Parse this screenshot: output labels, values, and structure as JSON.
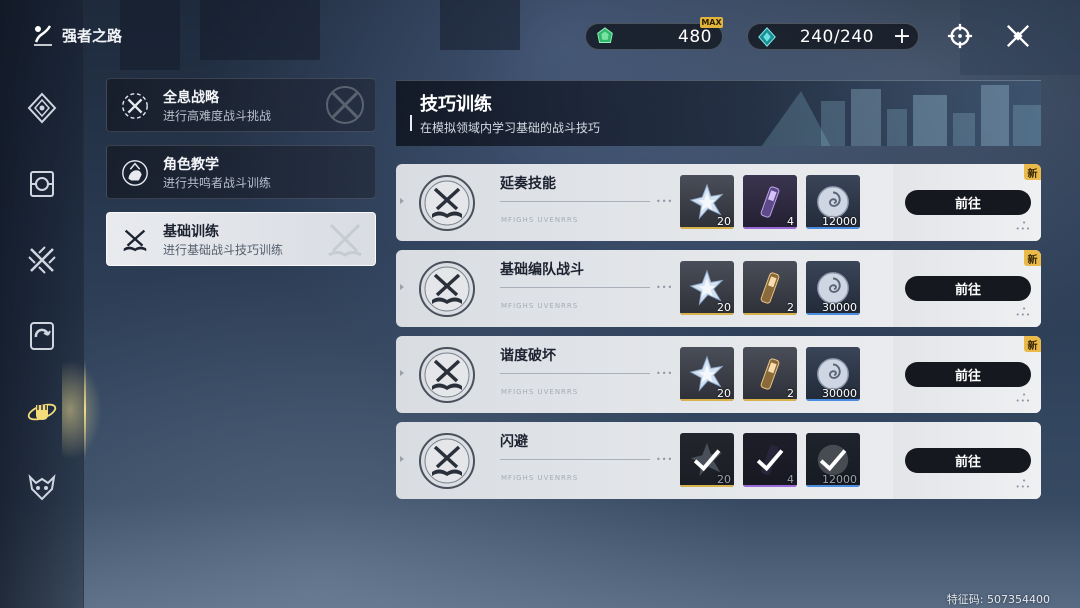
{
  "app": {
    "title": "强者之路"
  },
  "top_bar": {
    "currency_a": {
      "icon": "green-gem-icon",
      "value": "480",
      "badge": "MAX"
    },
    "currency_b": {
      "icon": "teal-crystal-icon",
      "value": "240/240",
      "plus": "+"
    },
    "icons": [
      "target-crosshair-icon",
      "close-x-icon"
    ]
  },
  "rail": {
    "items": [
      {
        "name": "diamond-emblem-icon",
        "active": false
      },
      {
        "name": "shield-card-icon",
        "active": false
      },
      {
        "name": "crossed-swords-icon",
        "active": false
      },
      {
        "name": "card-swirl-icon",
        "active": false
      },
      {
        "name": "fist-orbit-icon",
        "active": true
      },
      {
        "name": "demon-mask-icon",
        "active": false
      }
    ]
  },
  "categories": [
    {
      "title": "全息战略",
      "subtitle": "进行高难度战斗挑战",
      "active": false
    },
    {
      "title": "角色教学",
      "subtitle": "进行共鸣者战斗训练",
      "active": false
    },
    {
      "title": "基础训练",
      "subtitle": "进行基础战斗技巧训练",
      "active": true
    }
  ],
  "banner": {
    "title": "技巧训练",
    "subtitle": "在模拟领域内学习基础的战斗技巧"
  },
  "tasks": [
    {
      "name": "延奏技能",
      "deco": "MFIGHS   UVENRRS",
      "rewards": [
        {
          "type": "star-crystal",
          "rarity": "gold",
          "qty": "20",
          "claimed": false
        },
        {
          "type": "purple-vial",
          "rarity": "purple",
          "qty": "4",
          "claimed": false
        },
        {
          "type": "shell-coin",
          "rarity": "blue",
          "qty": "12000",
          "claimed": false
        }
      ],
      "button": "前往",
      "new_badge": "新"
    },
    {
      "name": "基础编队战斗",
      "deco": "MFIGHS   UVENRRS",
      "rewards": [
        {
          "type": "star-crystal",
          "rarity": "gold",
          "qty": "20",
          "claimed": false
        },
        {
          "type": "gold-vial",
          "rarity": "gold",
          "qty": "2",
          "claimed": false
        },
        {
          "type": "shell-coin",
          "rarity": "blue",
          "qty": "30000",
          "claimed": false
        }
      ],
      "button": "前往",
      "new_badge": "新"
    },
    {
      "name": "谐度破坏",
      "deco": "MFIGHS   UVENRRS",
      "rewards": [
        {
          "type": "star-crystal",
          "rarity": "gold",
          "qty": "20",
          "claimed": false
        },
        {
          "type": "gold-vial",
          "rarity": "gold",
          "qty": "2",
          "claimed": false
        },
        {
          "type": "shell-coin",
          "rarity": "blue",
          "qty": "30000",
          "claimed": false
        }
      ],
      "button": "前往",
      "new_badge": "新"
    },
    {
      "name": "闪避",
      "deco": "MFIGHS   UVENRRS",
      "rewards": [
        {
          "type": "star-crystal",
          "rarity": "gold",
          "qty": "20",
          "claimed": true
        },
        {
          "type": "purple-vial",
          "rarity": "purple",
          "qty": "4",
          "claimed": true
        },
        {
          "type": "shell-coin",
          "rarity": "blue",
          "qty": "12000",
          "claimed": true
        }
      ],
      "button": "前往",
      "new_badge": ""
    }
  ],
  "footer": {
    "feature_code": "特征码: 507354400"
  },
  "colors": {
    "accent_gold": "#e9b94a",
    "button_dark": "#15181e",
    "active_panel": "#e8eaee"
  }
}
